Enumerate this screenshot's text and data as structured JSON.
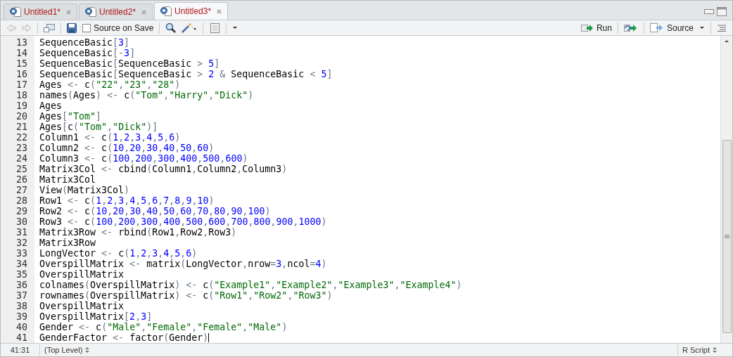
{
  "tabs": [
    {
      "label": "Untitled1*",
      "selected": false
    },
    {
      "label": "Untitled2*",
      "selected": false
    },
    {
      "label": "Untitled3*",
      "selected": true
    }
  ],
  "toolbar": {
    "source_on_save": {
      "label": "Source on Save",
      "checked": false
    },
    "run": "Run",
    "source": "Source"
  },
  "editor": {
    "lines": [
      {
        "number": "13",
        "code": "SequenceBasic[3]"
      },
      {
        "number": "14",
        "code": "SequenceBasic[-3]"
      },
      {
        "number": "15",
        "code": "SequenceBasic[SequenceBasic > 5]"
      },
      {
        "number": "16",
        "code": "SequenceBasic[SequenceBasic > 2 & SequenceBasic < 5]"
      },
      {
        "number": "17",
        "code": "Ages <- c(\"22\",\"23\",\"28\")"
      },
      {
        "number": "18",
        "code": "names(Ages) <- c(\"Tom\",\"Harry\",\"Dick\")"
      },
      {
        "number": "19",
        "code": "Ages"
      },
      {
        "number": "20",
        "code": "Ages[\"Tom\"]"
      },
      {
        "number": "21",
        "code": "Ages[c(\"Tom\",\"Dick\")]"
      },
      {
        "number": "22",
        "code": "Column1 <- c(1,2,3,4,5,6)"
      },
      {
        "number": "23",
        "code": "Column2 <- c(10,20,30,40,50,60)"
      },
      {
        "number": "24",
        "code": "Column3 <- c(100,200,300,400,500,600)"
      },
      {
        "number": "25",
        "code": "Matrix3Col <- cbind(Column1,Column2,Column3)"
      },
      {
        "number": "26",
        "code": "Matrix3Col"
      },
      {
        "number": "27",
        "code": "View(Matrix3Col)"
      },
      {
        "number": "28",
        "code": "Row1 <- c(1,2,3,4,5,6,7,8,9,10)"
      },
      {
        "number": "29",
        "code": "Row2 <- c(10,20,30,40,50,60,70,80,90,100)"
      },
      {
        "number": "30",
        "code": "Row3 <- c(100,200,300,400,500,600,700,800,900,1000)"
      },
      {
        "number": "31",
        "code": "Matrix3Row <- rbind(Row1,Row2,Row3)"
      },
      {
        "number": "32",
        "code": "Matrix3Row"
      },
      {
        "number": "33",
        "code": "LongVector <- c(1,2,3,4,5,6)"
      },
      {
        "number": "34",
        "code": "OverspillMatrix <- matrix(LongVector,nrow=3,ncol=4)"
      },
      {
        "number": "35",
        "code": "OverspillMatrix"
      },
      {
        "number": "36",
        "code": "colnames(OverspillMatrix) <- c(\"Example1\",\"Example2\",\"Example3\",\"Example4\")"
      },
      {
        "number": "37",
        "code": "rownames(OverspillMatrix) <- c(\"Row1\",\"Row2\",\"Row3\")"
      },
      {
        "number": "38",
        "code": "OverspillMatrix"
      },
      {
        "number": "39",
        "code": "OverspillMatrix[2,3]"
      },
      {
        "number": "40",
        "code": "Gender <- c(\"Male\",\"Female\",\"Female\",\"Male\")"
      },
      {
        "number": "41",
        "code": "GenderFactor <- factor(Gender)"
      }
    ]
  },
  "status_bar": {
    "position": "41:31",
    "scope": "(Top Level)",
    "file_type": "R Script"
  }
}
